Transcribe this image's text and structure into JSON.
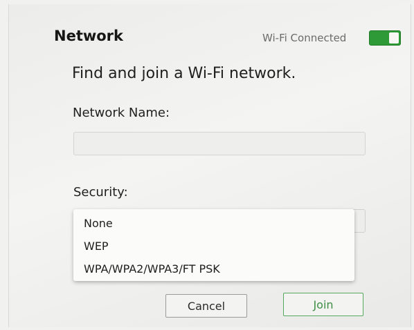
{
  "header": {
    "title": "Network",
    "wifi_status": "Wi-Fi Connected",
    "wifi_toggle_on": true
  },
  "form": {
    "heading": "Find and join a Wi-Fi network.",
    "network_name_label": "Network Name:",
    "network_name_value": "",
    "security_label": "Security:",
    "security_options": [
      "None",
      "WEP",
      "WPA/WPA2/WPA3/FT PSK"
    ]
  },
  "buttons": {
    "cancel": "Cancel",
    "join": "Join"
  },
  "colors": {
    "accent_green": "#2e9a37",
    "join_text": "#3d8f45"
  }
}
